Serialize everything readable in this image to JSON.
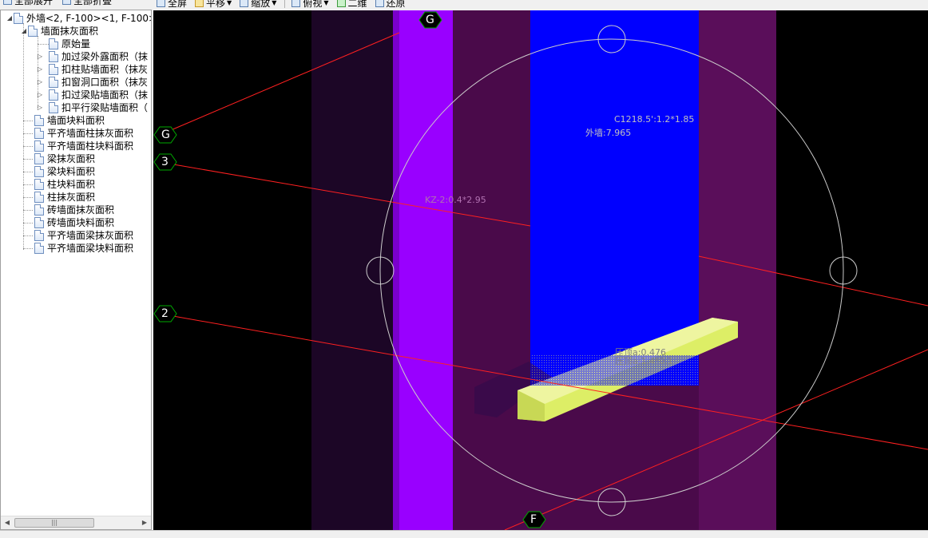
{
  "left_toolbar": {
    "expand_all": "全部展开",
    "collapse_all": "全部折叠"
  },
  "view_toolbar": {
    "fullscreen": "全屏",
    "pan": "平移",
    "zoom": "缩放",
    "view_mode": "俯视",
    "dimension": "二维",
    "restore": "还原"
  },
  "tree": {
    "root": "外墙<2, F-100><1, F-100>",
    "group": "墙面抹灰面积",
    "children": [
      "原始量",
      "加过梁外露面积（抹",
      "扣柱贴墙面积（抹灰",
      "扣窗洞口面积（抹灰",
      "扣过梁贴墙面积（抹",
      "扣平行梁贴墙面积（"
    ],
    "items": [
      "墙面块料面积",
      "平齐墙面柱抹灰面积",
      "平齐墙面柱块料面积",
      "梁抹灰面积",
      "梁块料面积",
      "柱块料面积",
      "柱抹灰面积",
      "砖墙面抹灰面积",
      "砖墙面块料面积",
      "平齐墙面梁抹灰面积",
      "平齐墙面梁块料面积"
    ]
  },
  "viewport": {
    "axis_labels": {
      "g_top": "G",
      "g_left": "G",
      "three": "3",
      "two": "2",
      "f": "F"
    },
    "window_label": "C1218.5':1.2*1.85",
    "wall_label": "外墙:7.965",
    "column_label": "KZ-2:0.4*2.95",
    "sill_label_1": "压顶a:0.476",
    "sill_label_2": "压顶a:1.4*0.1"
  },
  "colors": {
    "background": "#000000",
    "column": "#9900ff",
    "wall": "#4a0a4a",
    "wall_dark": "#1a0620",
    "window": "#0000ff",
    "sill": "#ddee66",
    "grid_line": "#ff0000",
    "axis_circle": "#00aa00"
  },
  "icons": [
    "expand-icon",
    "collapse-icon",
    "fullscreen-icon",
    "pan-icon",
    "zoom-icon",
    "view-icon",
    "2d-icon",
    "restore-icon",
    "document-icon"
  ]
}
